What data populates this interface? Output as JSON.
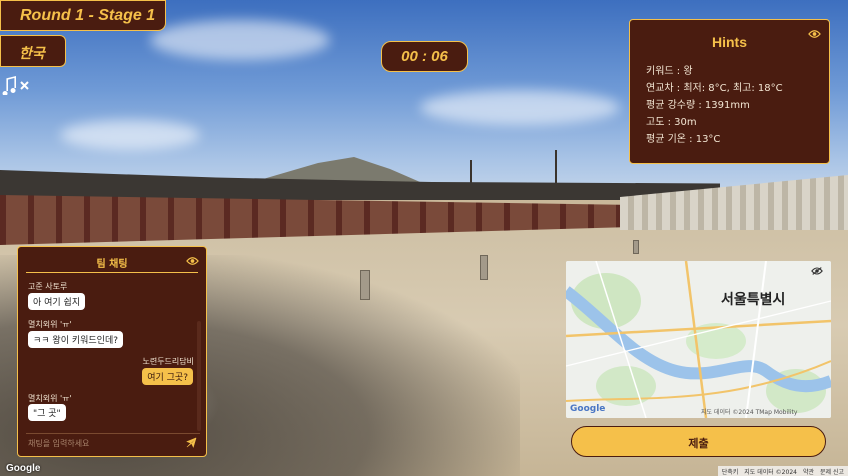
{
  "header": {
    "round": "Round 1 - Stage 1",
    "country": "한국",
    "timer": "00 : 06"
  },
  "hints": {
    "title": "Hints",
    "lines": [
      "키워드 : 왕",
      "연교차 : 최저: 8°C, 최고: 18°C",
      "평균 강수량 : 1391mm",
      "고도 : 30m",
      "평균 기온 : 13°C"
    ]
  },
  "chat": {
    "title": "팀 채팅",
    "messages": [
      {
        "name": "고준 사토루",
        "text": "아 여기 쉽지",
        "mine": false
      },
      {
        "name": "멸치외위 'ㅠ'",
        "text": "ㅋㅋ 왕이 키워드인데?",
        "mine": false
      },
      {
        "name": "노련두드리담비",
        "text": "여기 그곳?",
        "mine": true
      },
      {
        "name": "멸치외위 'ㅠ'",
        "text": "\"그 곳\"",
        "mine": false
      }
    ],
    "input_placeholder": "채팅을 입력하세요"
  },
  "map": {
    "city_label": "서울특별시",
    "attribution": "지도 데이터 ©2024 TMap Mobility",
    "brand": "Google"
  },
  "submit_label": "제출",
  "footer": {
    "brand": "Google",
    "links": [
      "단축키",
      "지도 데이터 ©2024",
      "약관",
      "문제 신고"
    ]
  },
  "colors": {
    "panel": "#4a1c10",
    "accent": "#f5c04a"
  },
  "icons": [
    "music-off-icon",
    "eye-icon",
    "send-icon"
  ]
}
